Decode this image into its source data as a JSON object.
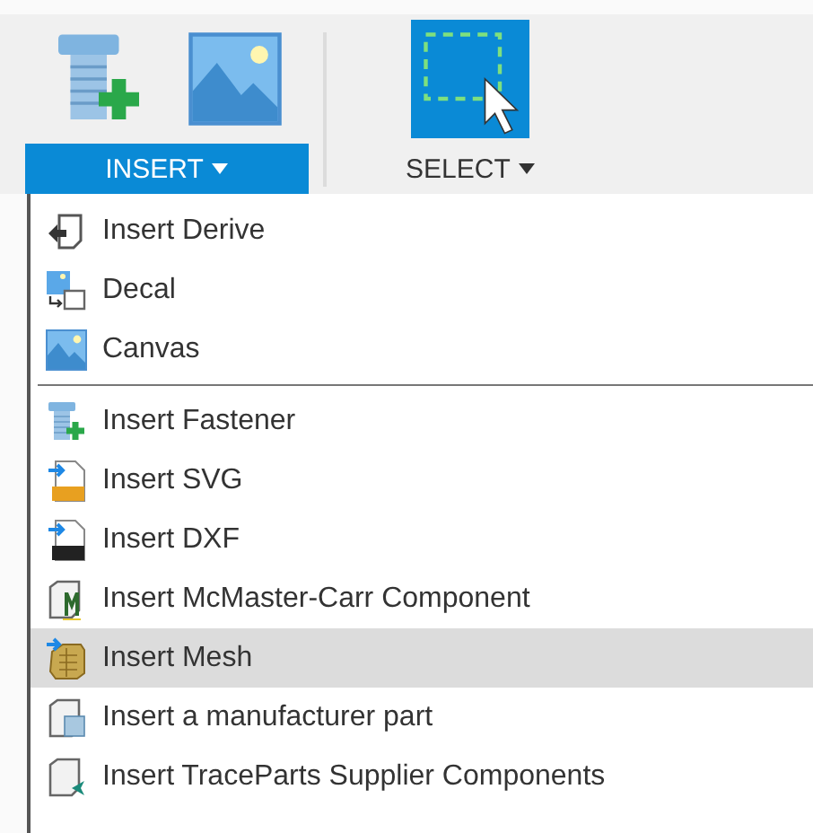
{
  "toolbar": {
    "groups": [
      {
        "label": "INSERT",
        "selected": true
      },
      {
        "label": "SELECT",
        "selected": false
      }
    ]
  },
  "menu": {
    "groups": [
      [
        {
          "label": "Insert Derive",
          "selected": false
        },
        {
          "label": "Decal",
          "selected": false
        },
        {
          "label": "Canvas",
          "selected": false
        }
      ],
      [
        {
          "label": "Insert Fastener",
          "selected": false
        },
        {
          "label": "Insert SVG",
          "selected": false
        },
        {
          "label": "Insert DXF",
          "selected": false
        },
        {
          "label": "Insert McMaster-Carr Component",
          "selected": false
        },
        {
          "label": "Insert Mesh",
          "selected": true
        },
        {
          "label": "Insert a manufacturer part",
          "selected": false
        },
        {
          "label": "Insert TraceParts Supplier Components",
          "selected": false
        }
      ]
    ]
  }
}
